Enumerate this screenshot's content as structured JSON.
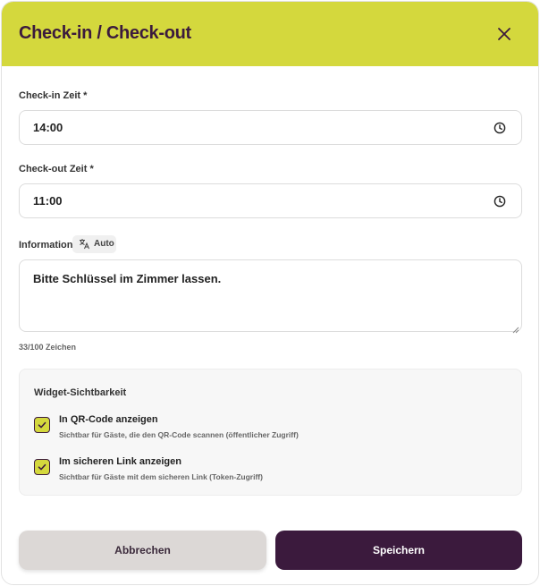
{
  "dialog": {
    "title": "Check-in / Check-out"
  },
  "checkin": {
    "label": "Check-in Zeit *",
    "value": "14:00"
  },
  "checkout": {
    "label": "Check-out Zeit *",
    "value": "11:00"
  },
  "information": {
    "label": "Information",
    "auto_badge": "Auto",
    "value": "Bitte Schlüssel im Zimmer lassen.",
    "counter": "33/100 Zeichen"
  },
  "visibility": {
    "title": "Widget-Sichtbarkeit",
    "options": [
      {
        "label": "In QR-Code anzeigen",
        "description": "Sichtbar für Gäste, die den QR-Code scannen (öffentlicher Zugriff)",
        "checked": true
      },
      {
        "label": "Im sicheren Link anzeigen",
        "description": "Sichtbar für Gäste mit dem sicheren Link (Token-Zugriff)",
        "checked": true
      }
    ]
  },
  "actions": {
    "cancel_label": "Abbrechen",
    "save_label": "Speichern"
  },
  "colors": {
    "header": "#d4d83d",
    "primary": "#3b1a3d",
    "cancel": "#dcd8d6"
  },
  "icons": {
    "close": "close-icon",
    "clock": "clock-icon",
    "translate": "translate-icon",
    "check": "checkmark-icon"
  }
}
